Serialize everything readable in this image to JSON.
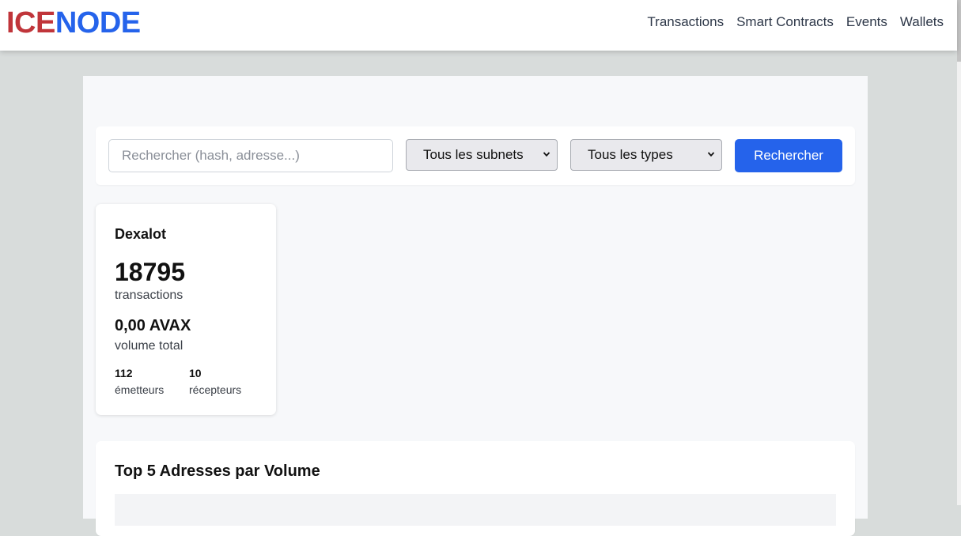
{
  "brand": {
    "part1": "ICE",
    "part2": "NODE"
  },
  "nav": [
    {
      "label": "Transactions"
    },
    {
      "label": "Smart Contracts"
    },
    {
      "label": "Events"
    },
    {
      "label": "Wallets"
    }
  ],
  "search": {
    "placeholder": "Rechercher (hash, adresse...)",
    "subnet_select": "Tous les subnets",
    "type_select": "Tous les types",
    "button_label": "Rechercher"
  },
  "subnet_card": {
    "name": "Dexalot",
    "transactions_value": "18795",
    "transactions_label": "transactions",
    "volume_value": "0,00 AVAX",
    "volume_label": "volume total",
    "senders_value": "112",
    "senders_label": "émetteurs",
    "receivers_value": "10",
    "receivers_label": "récepteurs"
  },
  "top_addresses": {
    "title": "Top 5 Adresses par Volume"
  },
  "colors": {
    "accent": "#2563eb",
    "brand_red": "#c0353a"
  }
}
